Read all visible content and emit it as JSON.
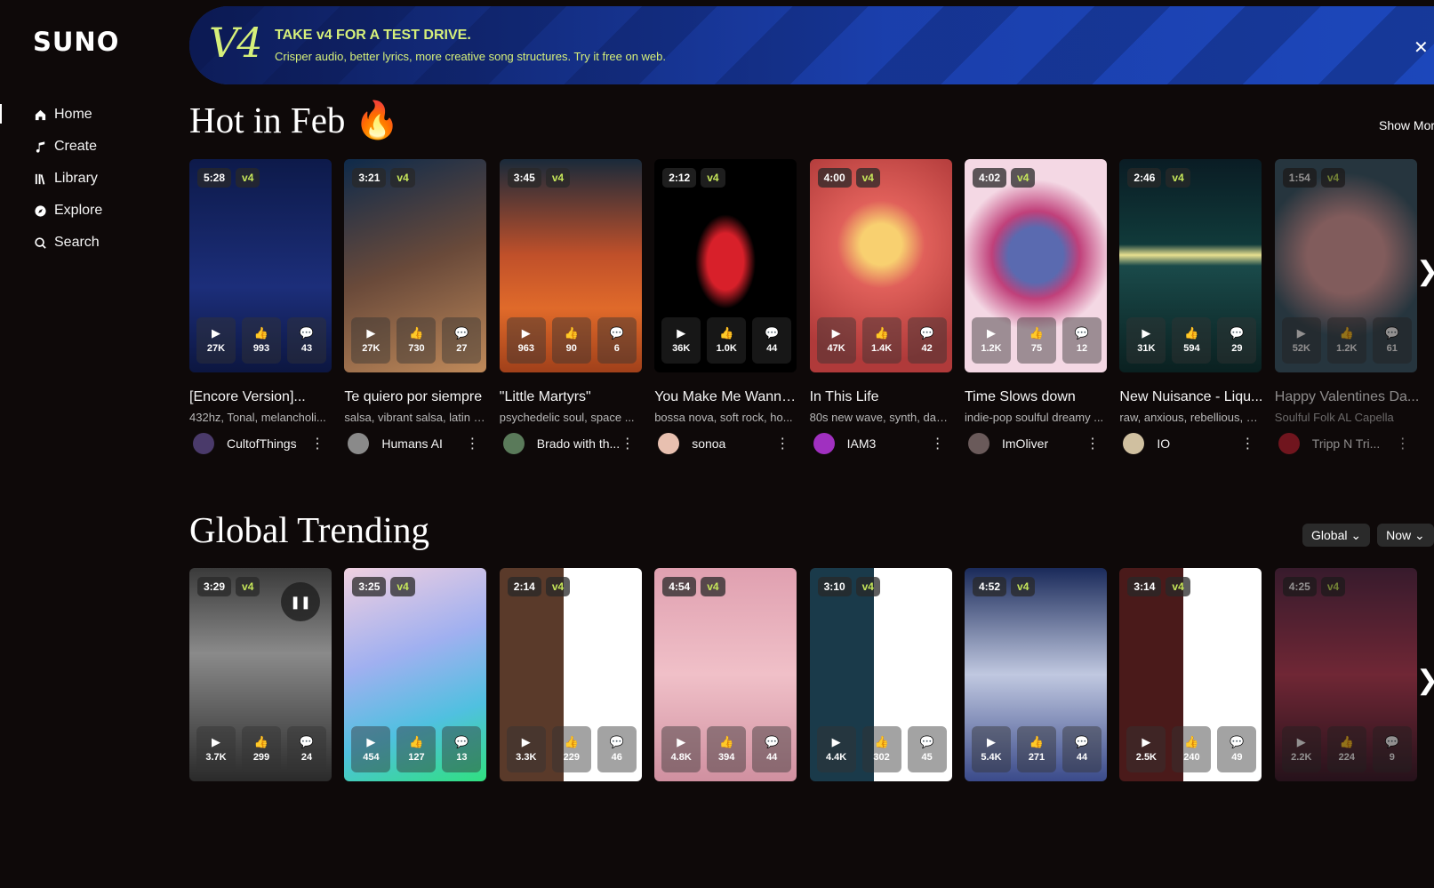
{
  "app": {
    "logo": "SUNO"
  },
  "sidebar": {
    "items": [
      {
        "label": "Home",
        "icon": "home-icon"
      },
      {
        "label": "Create",
        "icon": "music-note-icon"
      },
      {
        "label": "Library",
        "icon": "library-icon"
      },
      {
        "label": "Explore",
        "icon": "compass-icon"
      },
      {
        "label": "Search",
        "icon": "search-icon"
      }
    ]
  },
  "banner": {
    "logo": "V4",
    "title": "TAKE v4 FOR A TEST DRIVE.",
    "subtitle": "Crisper audio, better lyrics, more creative song structures. Try it free on web.",
    "close": "✕"
  },
  "hot": {
    "title": "Hot in Feb 🔥",
    "show_more": "Show More",
    "cards": [
      {
        "duration": "5:28",
        "version": "v4",
        "plays": "27K",
        "likes": "993",
        "comments": "43",
        "title": "[Encore Version]...",
        "tags": "432hz, Tonal, melancholi...",
        "user": "CultofThings",
        "bg": "linear-gradient(180deg,#0d1a4a,#1c2e7a 60%,#0c1640)",
        "av": "#4a3a6a"
      },
      {
        "duration": "3:21",
        "version": "v4",
        "plays": "27K",
        "likes": "730",
        "comments": "27",
        "title": "Te quiero por siempre",
        "tags": "salsa, vibrant salsa, latin s...",
        "user": "Humans AI",
        "bg": "linear-gradient(160deg,#0e2a4a,#6a4a3a 50%,#c08a5a)",
        "av": "#8a8a8a"
      },
      {
        "duration": "3:45",
        "version": "v4",
        "plays": "963",
        "likes": "90",
        "comments": "6",
        "title": "\"Little Martyrs\"",
        "tags": "psychedelic soul, space ...",
        "user": "Brado with th...",
        "bg": "linear-gradient(180deg,#1a2a3a,#c0502a 45%,#e06a2a 70%,#a0401a)",
        "av": "#5a7a5a"
      },
      {
        "duration": "2:12",
        "version": "v4",
        "plays": "36K",
        "likes": "1.0K",
        "comments": "44",
        "title": "You Make Me Wanna...",
        "tags": "bossa nova, soft rock, ho...",
        "user": "sonoa",
        "bg": "radial-gradient(ellipse at 50% 48%,#d8202a 0 18%,#000 30%)",
        "av": "#e8c0b0"
      },
      {
        "duration": "4:00",
        "version": "v4",
        "plays": "47K",
        "likes": "1.4K",
        "comments": "42",
        "title": "In This Life",
        "tags": "80s new wave, synth, dan...",
        "user": "IAM3",
        "bg": "radial-gradient(circle at 50% 40%,#f8d070 0 14%,#e0605a 30%,#b03a3a 80%)",
        "av": "#a030c0"
      },
      {
        "duration": "4:02",
        "version": "v4",
        "plays": "1.2K",
        "likes": "75",
        "comments": "12",
        "title": "Time Slows down",
        "tags": "indie-pop soulful dreamy ...",
        "user": "ImOliver",
        "bg": "radial-gradient(circle at 50% 45%,#5a6ab0 0 20%,#c0407a 32%,#f4d8e4 55%)",
        "av": "#6a5a5a"
      },
      {
        "duration": "2:46",
        "version": "v4",
        "plays": "31K",
        "likes": "594",
        "comments": "29",
        "title": "New Nuisance - Liqu...",
        "tags": "raw, anxious, rebellious, p...",
        "user": "IO",
        "bg": "linear-gradient(180deg,#0a1c24,#103a3a 40%,#e8e090 45%,#1a4a4a 50%,#0a2020)",
        "av": "#d0c0a0"
      },
      {
        "duration": "1:54",
        "version": "v4",
        "plays": "52K",
        "likes": "1.2K",
        "comments": "61",
        "title": "Happy Valentines Da...",
        "tags": "Soulful Folk AL Capella",
        "user": "Tripp N Tri...",
        "bg": "radial-gradient(circle at 50% 45%,#e0a0a0 0 28%,#3a5a6a 60%)",
        "av": "#c02030"
      }
    ]
  },
  "trending": {
    "title": "Global Trending",
    "filters": [
      "Global",
      "Now"
    ],
    "cards": [
      {
        "duration": "3:29",
        "version": "v4",
        "plays": "3.7K",
        "likes": "299",
        "comments": "24",
        "bg": "linear-gradient(180deg,#3a3a3a,#8a8a8a 40%,#2a2a2a)"
      },
      {
        "duration": "3:25",
        "version": "v4",
        "plays": "454",
        "likes": "127",
        "comments": "13",
        "bg": "linear-gradient(160deg,#f0d0e0,#a0b0f0 40%,#50c0e0 70%,#30e080)"
      },
      {
        "duration": "2:14",
        "version": "v4",
        "plays": "3.3K",
        "likes": "229",
        "comments": "46",
        "bg": "linear-gradient(90deg,#5a3a2a 0 45%,#ffffff 45%)"
      },
      {
        "duration": "4:54",
        "version": "v4",
        "plays": "4.8K",
        "likes": "394",
        "comments": "44",
        "bg": "linear-gradient(180deg,#e0a0b0,#f0c0c8 50%,#d090a0)"
      },
      {
        "duration": "3:10",
        "version": "v4",
        "plays": "4.4K",
        "likes": "302",
        "comments": "45",
        "bg": "linear-gradient(90deg,#1a3a4a 0 45%,#ffffff 45%)"
      },
      {
        "duration": "4:52",
        "version": "v4",
        "plays": "5.4K",
        "likes": "271",
        "comments": "44",
        "bg": "linear-gradient(180deg,#1a2a5a,#c0c8e0 50%,#3a4a8a)"
      },
      {
        "duration": "3:14",
        "version": "v4",
        "plays": "2.5K",
        "likes": "240",
        "comments": "49",
        "bg": "linear-gradient(90deg,#4a1a1a 0 45%,#ffffff 45%)"
      },
      {
        "duration": "4:25",
        "version": "v4",
        "plays": "2.2K",
        "likes": "224",
        "comments": "9",
        "bg": "linear-gradient(180deg,#5a2a4a,#c0405a 50%,#3a1a2a)"
      }
    ]
  }
}
